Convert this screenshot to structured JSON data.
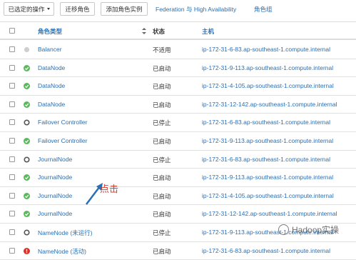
{
  "toolbar": {
    "selected_actions": "已选定的操作",
    "migrate_roles": "迁移角色",
    "add_role_instance": "添加角色实例",
    "federation_ha": "Federation 与 High Availability",
    "role_groups": "角色组"
  },
  "table": {
    "headers": {
      "role_type": "角色类型",
      "status": "状态",
      "host": "主机"
    },
    "rows": [
      {
        "role": "Balancer",
        "state": "不适用",
        "host": "ip-172-31-6-83.ap-southeast-1.compute.internal",
        "icon": "grey-dot-icon"
      },
      {
        "role": "DataNode",
        "state": "已启动",
        "host": "ip-172-31-9-113.ap-southeast-1.compute.internal",
        "icon": "green-check-icon"
      },
      {
        "role": "DataNode",
        "state": "已启动",
        "host": "ip-172-31-4-105.ap-southeast-1.compute.internal",
        "icon": "green-check-icon"
      },
      {
        "role": "DataNode",
        "state": "已启动",
        "host": "ip-172-31-12-142.ap-southeast-1.compute.internal",
        "icon": "green-check-icon"
      },
      {
        "role": "Failover Controller",
        "state": "已停止",
        "host": "ip-172-31-6-83.ap-southeast-1.compute.internal",
        "icon": "stopped-circle-icon"
      },
      {
        "role": "Failover Controller",
        "state": "已启动",
        "host": "ip-172-31-9-113.ap-southeast-1.compute.internal",
        "icon": "green-check-icon"
      },
      {
        "role": "JournalNode",
        "state": "已停止",
        "host": "ip-172-31-6-83.ap-southeast-1.compute.internal",
        "icon": "stopped-circle-icon"
      },
      {
        "role": "JournalNode",
        "state": "已启动",
        "host": "ip-172-31-9-113.ap-southeast-1.compute.internal",
        "icon": "green-check-icon"
      },
      {
        "role": "JournalNode",
        "state": "已启动",
        "host": "ip-172-31-4-105.ap-southeast-1.compute.internal",
        "icon": "green-check-icon"
      },
      {
        "role": "JournalNode",
        "state": "已启动",
        "host": "ip-172-31-12-142.ap-southeast-1.compute.internal",
        "icon": "green-check-icon"
      },
      {
        "role": "NameNode (未运行)",
        "state": "已停止",
        "host": "ip-172-31-9-113.ap-southeast-1.compute.internal",
        "icon": "stopped-circle-icon"
      },
      {
        "role": "NameNode (活动)",
        "state": "已启动",
        "host": "ip-172-31-6-83.ap-southeast-1.compute.internal",
        "icon": "red-alert-icon"
      }
    ]
  },
  "annotation": {
    "text": "点击"
  },
  "watermark": {
    "text": "Hadoop实操"
  },
  "colors": {
    "link": "#2a6fb3",
    "green": "#5cb85c",
    "red": "#d9322a",
    "grey": "#bbbbbb",
    "annotation": "#e03a2a"
  }
}
